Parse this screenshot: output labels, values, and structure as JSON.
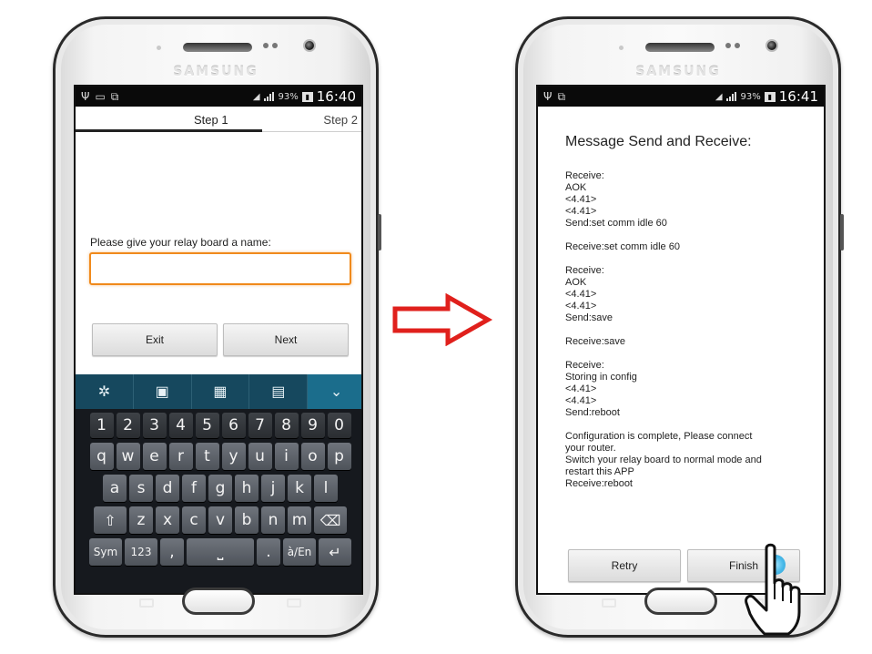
{
  "left_phone": {
    "brand": "SAMSUNG",
    "status": {
      "battery": "93%",
      "time": "16:40"
    },
    "tabs": [
      {
        "label": "Step 1"
      },
      {
        "label": "Step 2"
      }
    ],
    "prompt": "Please give your relay board a name:",
    "name_input": {
      "value": "",
      "placeholder": ""
    },
    "buttons": {
      "exit": "Exit",
      "next": "Next"
    },
    "keyboard": {
      "digits": [
        "1",
        "2",
        "3",
        "4",
        "5",
        "6",
        "7",
        "8",
        "9",
        "0"
      ],
      "row1": [
        "q",
        "w",
        "e",
        "r",
        "t",
        "y",
        "u",
        "i",
        "o",
        "p"
      ],
      "row2": [
        "a",
        "s",
        "d",
        "f",
        "g",
        "h",
        "j",
        "k",
        "l"
      ],
      "row3": [
        "z",
        "x",
        "c",
        "v",
        "b",
        "n",
        "m"
      ],
      "sym": "Sym",
      "num": "123",
      "comma": ",",
      "period": ".",
      "lang": "à/En"
    }
  },
  "right_phone": {
    "brand": "SAMSUNG",
    "status": {
      "battery": "93%",
      "time": "16:41"
    },
    "title": "Message Send and Receive:",
    "log": [
      "Receive:",
      "AOK",
      "<4.41>",
      "<4.41>",
      "Send:set comm idle 60",
      "",
      "Receive:set comm idle 60",
      "",
      "Receive:",
      "AOK",
      "<4.41>",
      "<4.41>",
      "Send:save",
      "",
      "Receive:save",
      "",
      "Receive:",
      "Storing in config",
      "<4.41>",
      "<4.41>",
      "Send:reboot",
      "",
      "Configuration is complete, Please connect",
      "your router.",
      "Switch your relay board to normal mode and",
      "restart this APP",
      "Receive:reboot"
    ],
    "buttons": {
      "retry": "Retry",
      "finish": "Finish"
    }
  },
  "colors": {
    "input_focus": "#f08a1c",
    "keyboard_toolbar": "#16485e",
    "arrow": "#e0201c",
    "tap_highlight": "#3fb6e8"
  }
}
